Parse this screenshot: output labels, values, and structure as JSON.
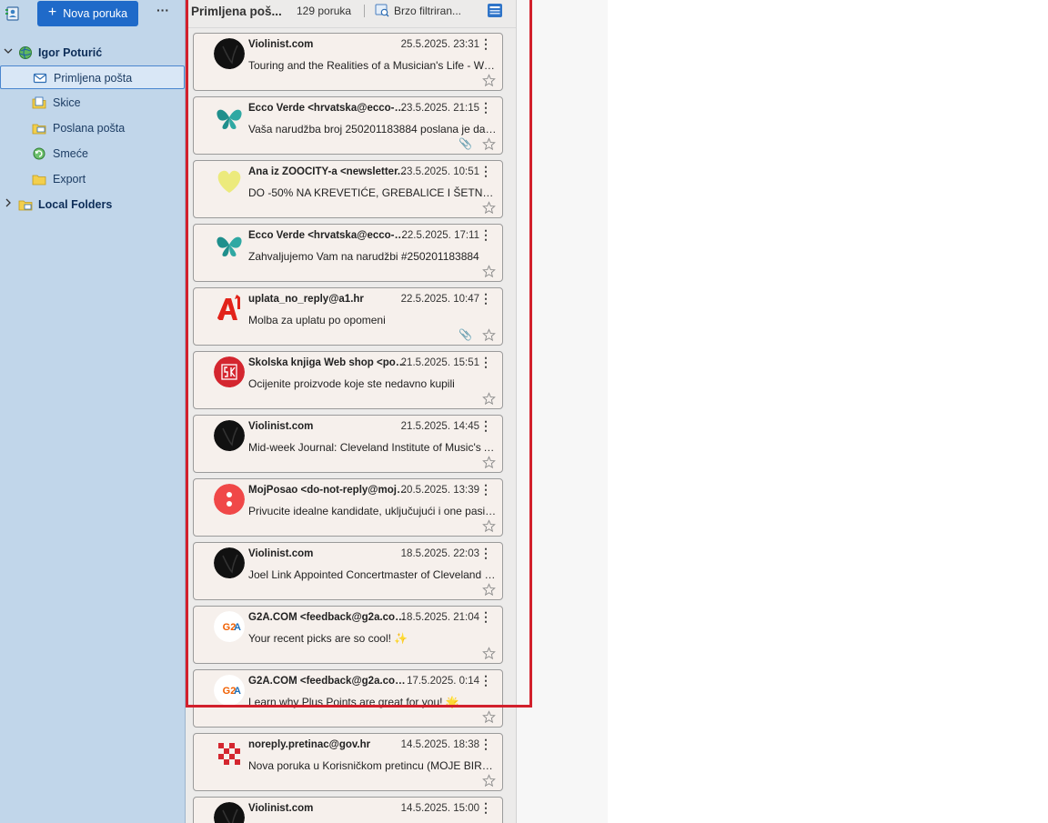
{
  "toolbar": {
    "new_message": "Nova poruka",
    "more": "···"
  },
  "account": {
    "name": "Igor Poturić"
  },
  "folders": [
    {
      "label": "Primljena pošta",
      "icon": "inbox-icon",
      "selected": true
    },
    {
      "label": "Skice",
      "icon": "drafts-icon"
    },
    {
      "label": "Poslana pošta",
      "icon": "sent-icon"
    },
    {
      "label": "Smeće",
      "icon": "trash-icon"
    },
    {
      "label": "Export",
      "icon": "folder-icon"
    }
  ],
  "local_folders": {
    "label": "Local Folders"
  },
  "list_header": {
    "folder": "Primljena poš...",
    "count": "129 poruka",
    "quick_filter": "Brzo filtriran..."
  },
  "messages": [
    {
      "sender": "Violinist.com",
      "date": "25.5.2025. 23:31",
      "subject": "Touring and the Realities of a Musician's Life - We...",
      "avatar": "violinist-logo",
      "attachment": false
    },
    {
      "sender": "Ecco Verde <hrvatska@ecco-ve...",
      "date": "23.5.2025. 21:15",
      "subject": "Vaša narudžba broj 250201183884 poslana je dan...",
      "avatar": "ecco-verde-logo",
      "attachment": true
    },
    {
      "sender": "Ana iz ZOOCITY-a <newsletter...",
      "date": "23.5.2025. 10:51",
      "subject": "DO -50% NA KREVETIĆE, GREBALICE I ŠETNJU!",
      "avatar": "zoocity-heart-logo",
      "attachment": false
    },
    {
      "sender": "Ecco Verde <hrvatska@ecco-ve...",
      "date": "22.5.2025. 17:11",
      "subject": "Zahvaljujemo Vam na narudžbi #250201183884",
      "avatar": "ecco-verde-logo",
      "attachment": false
    },
    {
      "sender": "uplata_no_reply@a1.hr",
      "date": "22.5.2025. 10:47",
      "subject": "Molba za uplatu po opomeni",
      "avatar": "a1-logo",
      "attachment": true
    },
    {
      "sender": "Školska knjiga Web shop <pod...",
      "date": "21.5.2025. 15:51",
      "subject": "Ocijenite proizvode koje ste nedavno kupili",
      "avatar": "skolska-knjiga-logo",
      "attachment": false
    },
    {
      "sender": "Violinist.com",
      "date": "21.5.2025. 14:45",
      "subject": "Mid-week Journal: Cleveland Institute of Music's A...",
      "avatar": "violinist-logo",
      "attachment": false
    },
    {
      "sender": "MojPosao <do-not-reply@moj-...",
      "date": "20.5.2025. 13:39",
      "subject": "Privucite idealne kandidate, uključujući i one pasiv...",
      "avatar": "mojposao-logo",
      "attachment": false
    },
    {
      "sender": "Violinist.com",
      "date": "18.5.2025. 22:03",
      "subject": "Joel Link Appointed Concertmaster of Cleveland O...",
      "avatar": "violinist-logo",
      "attachment": false
    },
    {
      "sender": "G2A.COM <feedback@g2a.com>",
      "date": "18.5.2025. 21:04",
      "subject": "Your recent picks are so cool! ✨",
      "avatar": "g2a-logo",
      "attachment": false
    },
    {
      "sender": "G2A.COM <feedback@g2a.com>",
      "date": "17.5.2025. 0:14",
      "subject": "Learn why Plus Points are great for you! 🌟",
      "avatar": "g2a-logo",
      "attachment": false
    },
    {
      "sender": "noreply.pretinac@gov.hr",
      "date": "14.5.2025. 18:38",
      "subject": "Nova poruka u Korisničkom pretincu (MOJE BIRAČ...",
      "avatar": "gov-hr-checker-logo",
      "attachment": false
    },
    {
      "sender": "Violinist.com",
      "date": "14.5.2025. 15:00",
      "subject": "",
      "avatar": "violinist-logo",
      "attachment": false
    }
  ],
  "colors": {
    "accent": "#1f6ac9",
    "highlight": "#d2202c",
    "folder_pane": "#c1d6ea",
    "card": "#f6f0ec"
  }
}
